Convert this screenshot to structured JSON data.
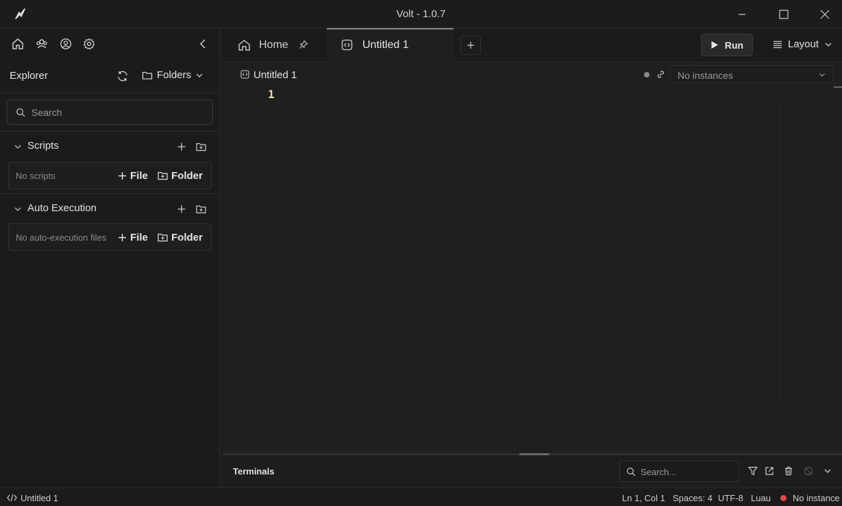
{
  "window": {
    "title": "Volt - 1.0.7"
  },
  "sidebar": {
    "explorer_label": "Explorer",
    "folders_label": "Folders",
    "search_placeholder": "Search",
    "scripts": {
      "title": "Scripts",
      "empty": "No scripts",
      "file_label": "File",
      "folder_label": "Folder"
    },
    "auto_execution": {
      "title": "Auto Execution",
      "empty": "No auto-execution files",
      "file_label": "File",
      "folder_label": "Folder"
    }
  },
  "tabs": [
    {
      "label": "Home",
      "pinned": true
    },
    {
      "label": "Untitled 1",
      "active": true
    }
  ],
  "toolbar": {
    "run_label": "Run",
    "layout_label": "Layout"
  },
  "editor": {
    "file_name": "Untitled 1",
    "instances_select": "No instances",
    "line_number": "1"
  },
  "terminals": {
    "title": "Terminals",
    "search_placeholder": "Search..."
  },
  "status": {
    "file": "Untitled 1",
    "cursor": "Ln 1, Col 1",
    "spaces": "Spaces: 4",
    "encoding": "UTF-8",
    "language": "Luau",
    "instance": "No instance"
  },
  "colors": {
    "background": "#1f1f1f",
    "sidebar": "#1b1b1b",
    "status_dot": "#e5484d",
    "line_number": "#e8e0b0"
  }
}
